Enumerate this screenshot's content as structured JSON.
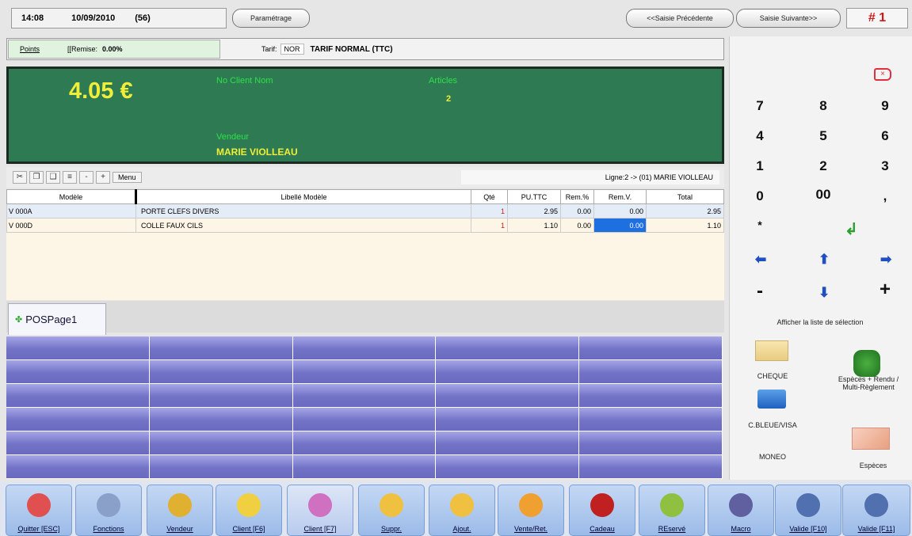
{
  "header": {
    "time": "14:08",
    "date": "10/09/2010",
    "count": "(56)",
    "settings_label": "Paramétrage",
    "prev_label": "<<Saisie Précédente",
    "next_label": "Saisie Suivante>>",
    "ticket": "# 1"
  },
  "info": {
    "points_label": "Points",
    "discount_label": "[[Remise:",
    "discount_value": "0.00%",
    "tariff_label": "Tarif:",
    "tariff_code": "NOR",
    "tariff_name": "TARIF NORMAL (TTC)"
  },
  "display": {
    "amount": "4.05 €",
    "client_title": "No Client Nom",
    "articles_title": "Articles",
    "articles_count": "2",
    "seller_title": "Vendeur",
    "seller_name": "MARIE VIOLLEAU"
  },
  "toolbar": {
    "menu_label": "Menu",
    "line_info": "Ligne:2 -> (01) MARIE VIOLLEAU"
  },
  "table": {
    "headers": [
      "Modèle",
      "Libellé Modèle",
      "Qté",
      "PU.TTC",
      "Rem.%",
      "Rem.V.",
      "Total"
    ],
    "rows": [
      {
        "flag": "V",
        "model": "000A",
        "label": "PORTE CLEFS DIVERS",
        "qty": "1",
        "pu": "2.95",
        "rem_pct": "0.00",
        "rem_v": "0.00",
        "total": "2.95"
      },
      {
        "flag": "V",
        "model": "000D",
        "label": "COLLE FAUX CILS",
        "qty": "1",
        "pu": "1.10",
        "rem_pct": "0.00",
        "rem_v": "0.00",
        "total": "1.10"
      }
    ]
  },
  "tab": {
    "label": "POSPage1"
  },
  "keypad": {
    "keys": [
      "7",
      "8",
      "9",
      "4",
      "5",
      "6",
      "1",
      "2",
      "3",
      "0",
      "00",
      ",",
      "*"
    ],
    "minus": "-",
    "plus": "+",
    "list_label": "Afficher la liste de sélection"
  },
  "payments": {
    "cheque": "CHEQUE",
    "cash_multi_1": "Espèces + Rendu /",
    "cash_multi_2": "Multi-Règlement",
    "card": "C.BLEUE/VISA",
    "moneo": "MONEO",
    "cash": "Espèces"
  },
  "bottom": [
    {
      "label": "Quitter [ESC]",
      "color": "#e05050",
      "name": "quit-button"
    },
    {
      "label": "Fonctions",
      "color": "#8aa0c8",
      "name": "functions-button"
    },
    {
      "label": "Vendeur",
      "color": "#e0b030",
      "name": "seller-button"
    },
    {
      "label": "Client [F6]",
      "color": "#f0d040",
      "name": "client-button"
    },
    {
      "label": "Client [F7]",
      "color": "#d070c0",
      "name": "client-f7-button"
    },
    {
      "label": "Suppr.",
      "color": "#f0c040",
      "name": "delete-button"
    },
    {
      "label": "Ajout.",
      "color": "#f0c040",
      "name": "add-button"
    },
    {
      "label": "Vente/Ret.",
      "color": "#f0a030",
      "name": "sale-return-button"
    },
    {
      "label": "Cadeau",
      "color": "#c02020",
      "name": "gift-button"
    },
    {
      "label": "REservé",
      "color": "#90c040",
      "name": "reserved-button"
    },
    {
      "label": "Macro",
      "color": "#6060a0",
      "name": "macro-button"
    },
    {
      "label": "Valide [F10]",
      "color": "#5070b0",
      "name": "validate-f10-button"
    },
    {
      "label": "Valide [F11]",
      "color": "#5070b0",
      "name": "validate-f11-button"
    }
  ]
}
